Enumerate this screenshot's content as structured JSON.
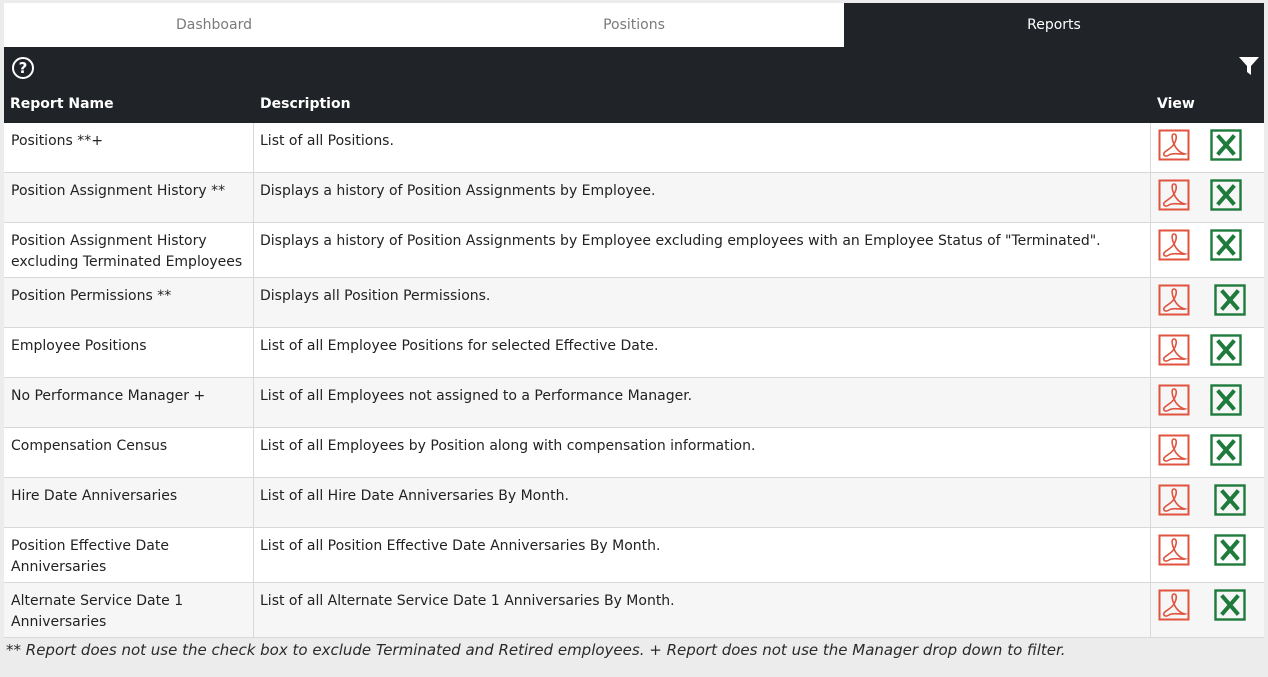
{
  "tabs": [
    "Dashboard",
    "Positions",
    "Reports"
  ],
  "active_tab": "Reports",
  "toolbar": {
    "help_icon": "question-circle-icon",
    "filter_icon": "filter-icon",
    "help_glyph": "?"
  },
  "table": {
    "headers": [
      "Report Name",
      "Description",
      "View"
    ],
    "rows": [
      {
        "name": "Positions **+",
        "description": "List of all Positions."
      },
      {
        "name": "Position Assignment History **",
        "description": "Displays a history of Position Assignments by Employee."
      },
      {
        "name": "Position Assignment History excluding Terminated Employees",
        "description": "Displays a history of Position Assignments by Employee excluding employees with an Employee Status of \"Terminated\"."
      },
      {
        "name": "Position Permissions **",
        "description": "Displays all Position Permissions."
      },
      {
        "name": "Employee Positions",
        "description": "List of all Employee Positions for selected Effective Date."
      },
      {
        "name": "No Performance Manager +",
        "description": "List of all Employees not assigned to a Performance Manager."
      },
      {
        "name": "Compensation Census",
        "description": "List of all Employees by Position along with compensation information."
      },
      {
        "name": "Hire Date Anniversaries",
        "description": "List of all Hire Date Anniversaries By Month."
      },
      {
        "name": "Position Effective Date Anniversaries",
        "description": "List of all Position Effective Date Anniversaries By Month."
      },
      {
        "name": "Alternate Service Date 1 Anniversaries",
        "description": "List of all Alternate Service Date 1 Anniversaries By Month."
      }
    ]
  },
  "footnote": "** Report does not use the check box to exclude Terminated and Retired employees. + Report does not use the Manager drop down to filter.",
  "colors": {
    "dark": "#202328",
    "pdf": "#e0533e",
    "excel": "#1e7b3c"
  }
}
